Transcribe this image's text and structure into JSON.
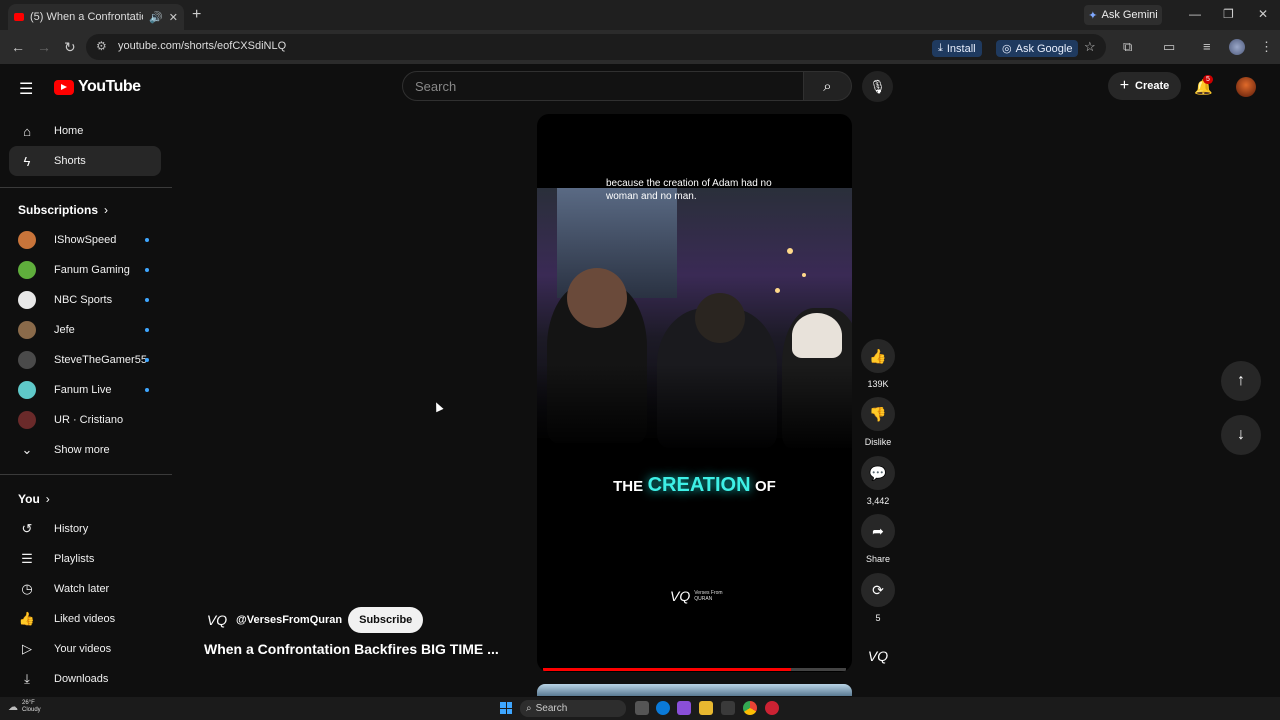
{
  "browser": {
    "tab_title": "(5) When a Confrontation B",
    "new_tab_label": "+",
    "ask_gemini_label": "Ask Gemini",
    "url": "youtube.com/shorts/eofCXSdiNLQ",
    "install_label": "Install",
    "ask_google_label": "Ask Google"
  },
  "header": {
    "logo_text": "YouTube",
    "search_placeholder": "Search",
    "create_label": "Create",
    "notification_count": "5"
  },
  "sidebar": {
    "main": [
      {
        "label": "Home",
        "icon": "home-icon"
      },
      {
        "label": "Shorts",
        "icon": "shorts-icon",
        "active": true
      }
    ],
    "subscriptions_heading": "Subscriptions",
    "subscriptions": [
      {
        "label": "IShowSpeed",
        "color": "#c8743a"
      },
      {
        "label": "Fanum Gaming",
        "color": "#5fae3c"
      },
      {
        "label": "NBC Sports",
        "color": "#e8e8e8"
      },
      {
        "label": "Jefe",
        "color": "#8a6a4a"
      },
      {
        "label": "SteveTheGamer55",
        "color": "#4a4a4a"
      },
      {
        "label": "Fanum Live",
        "color": "#5fc9c9"
      },
      {
        "label": "UR · Cristiano",
        "color": "#6a2a2a"
      }
    ],
    "show_more_label": "Show more",
    "you_heading": "You",
    "you_items": [
      {
        "label": "History",
        "icon": "history-icon"
      },
      {
        "label": "Playlists",
        "icon": "playlists-icon"
      },
      {
        "label": "Watch later",
        "icon": "watch-later-icon"
      },
      {
        "label": "Liked videos",
        "icon": "liked-videos-icon"
      },
      {
        "label": "Your videos",
        "icon": "your-videos-icon"
      },
      {
        "label": "Downloads",
        "icon": "downloads-icon"
      }
    ]
  },
  "short": {
    "caption": "because the creation of Adam had no woman and no man.",
    "big_caption_1": "THE",
    "big_caption_2": "CREATION",
    "big_caption_3": "OF",
    "watermark_mark": "VQ",
    "watermark_text_1": "Verses From",
    "watermark_text_2": "QURAN",
    "progress_fraction": 0.82,
    "channel_handle": "@VersesFromQuran",
    "subscribe_label": "Subscribe",
    "title": "When a Confrontation Backfires BIG TIME ..."
  },
  "actions": {
    "likes": "139K",
    "dislike_label": "Dislike",
    "comments": "3,442",
    "share_label": "Share",
    "remix_count": "5"
  },
  "taskbar": {
    "temperature": "26°F",
    "condition": "Cloudy",
    "search_label": "Search"
  },
  "colors": {
    "accent_red": "#ff0000",
    "caption_cyan": "#3ef0e6",
    "subscribe_bg": "#f1f1f1"
  }
}
